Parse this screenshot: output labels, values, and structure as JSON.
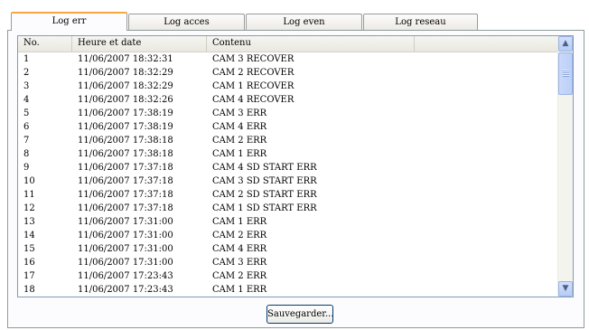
{
  "tabs": [
    {
      "label": "Log err",
      "active": true
    },
    {
      "label": "Log acces",
      "active": false
    },
    {
      "label": "Log even",
      "active": false
    },
    {
      "label": "Log reseau",
      "active": false
    }
  ],
  "table": {
    "headers": [
      "No.",
      "Heure et date",
      "Contenu",
      ""
    ],
    "rows": [
      [
        "1",
        "11/06/2007 18:32:31",
        "CAM 3 RECOVER"
      ],
      [
        "2",
        "11/06/2007 18:32:29",
        "CAM 2 RECOVER"
      ],
      [
        "3",
        "11/06/2007 18:32:29",
        "CAM 1 RECOVER"
      ],
      [
        "4",
        "11/06/2007 18:32:26",
        "CAM 4 RECOVER"
      ],
      [
        "5",
        "11/06/2007 17:38:19",
        "CAM 3 ERR"
      ],
      [
        "6",
        "11/06/2007 17:38:19",
        "CAM 4 ERR"
      ],
      [
        "7",
        "11/06/2007 17:38:18",
        "CAM 2 ERR"
      ],
      [
        "8",
        "11/06/2007 17:38:18",
        "CAM 1 ERR"
      ],
      [
        "9",
        "11/06/2007 17:37:18",
        "CAM 4 SD START ERR"
      ],
      [
        "10",
        "11/06/2007 17:37:18",
        "CAM 3 SD START ERR"
      ],
      [
        "11",
        "11/06/2007 17:37:18",
        "CAM 2 SD START ERR"
      ],
      [
        "12",
        "11/06/2007 17:37:18",
        "CAM 1 SD START ERR"
      ],
      [
        "13",
        "11/06/2007 17:31:00",
        "CAM 1 ERR"
      ],
      [
        "14",
        "11/06/2007 17:31:00",
        "CAM 2 ERR"
      ],
      [
        "15",
        "11/06/2007 17:31:00",
        "CAM 4 ERR"
      ],
      [
        "16",
        "11/06/2007 17:31:00",
        "CAM 3 ERR"
      ],
      [
        "17",
        "11/06/2007 17:23:43",
        "CAM 2 ERR"
      ],
      [
        "18",
        "11/06/2007 17:23:43",
        "CAM 1 ERR"
      ]
    ]
  },
  "scrollbar": {
    "up_icon": "▲",
    "down_icon": "▼"
  },
  "buttons": {
    "save_label": "Sauvegarder..."
  }
}
